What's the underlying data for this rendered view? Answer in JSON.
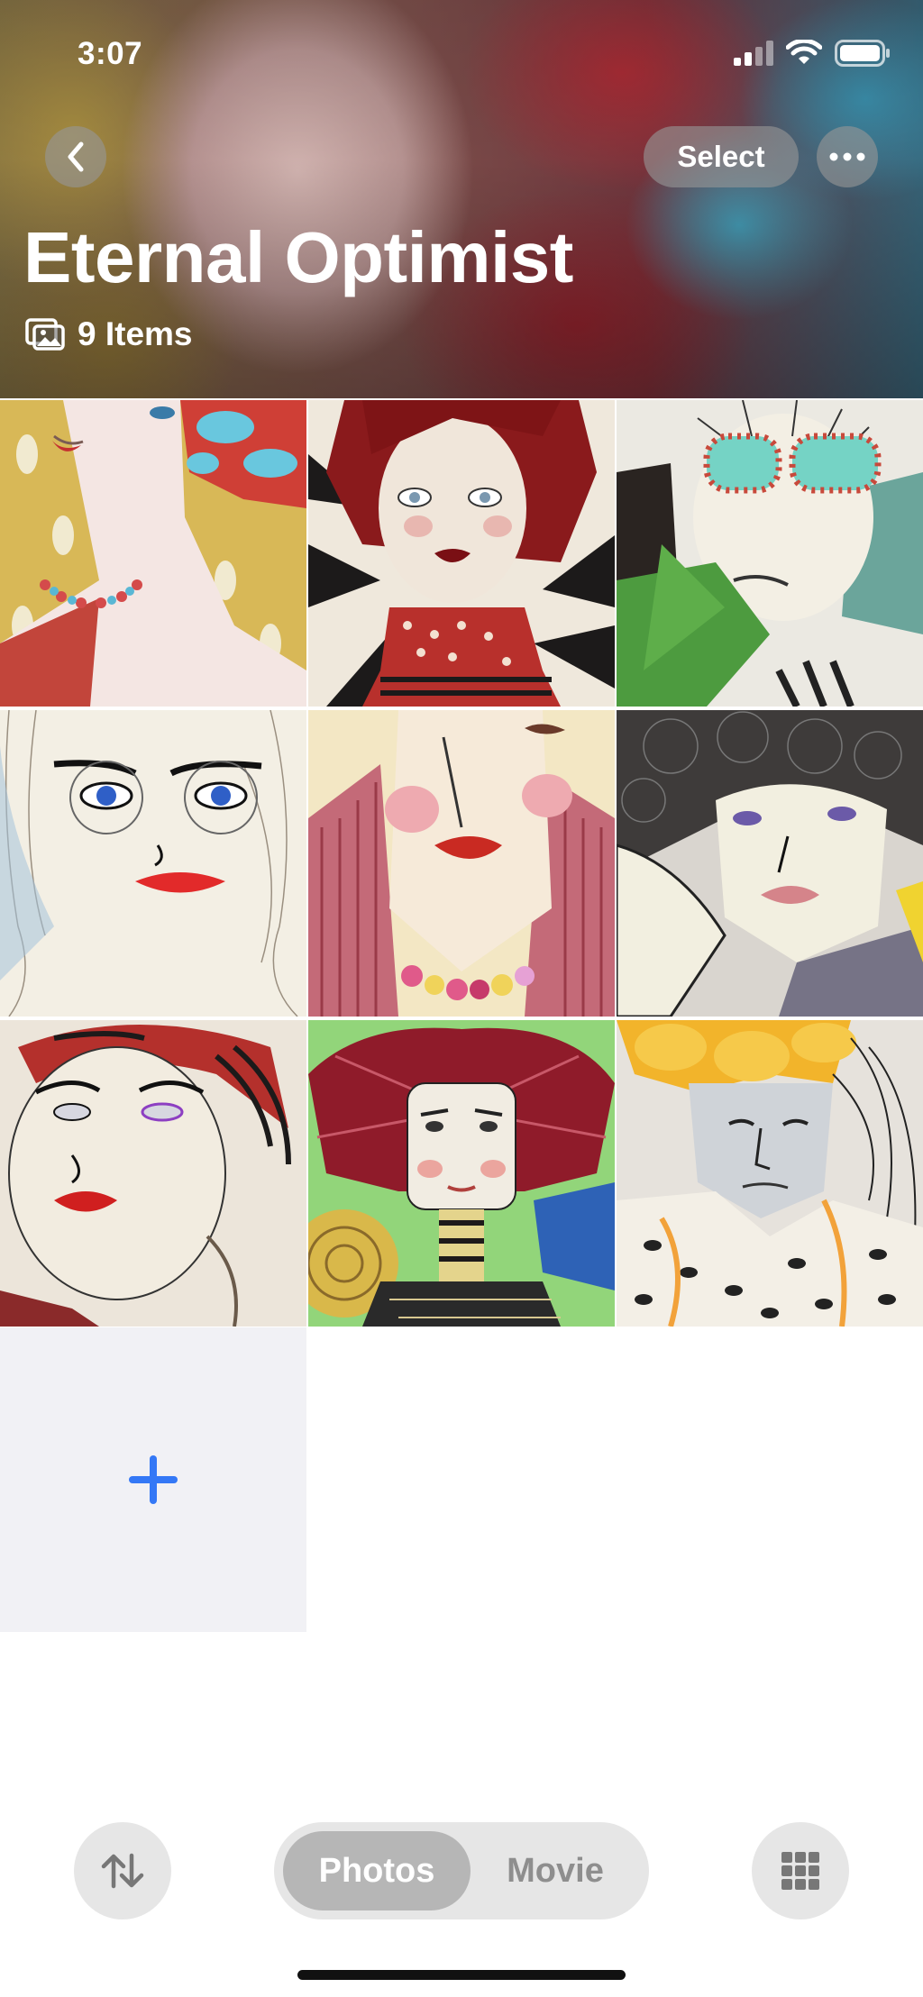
{
  "status_bar": {
    "time": "3:07",
    "icons": [
      "cellular-signal-icon",
      "wifi-icon",
      "battery-icon"
    ]
  },
  "nav": {
    "back_icon": "chevron-left-icon",
    "select_label": "Select",
    "more_icon": "ellipsis-icon"
  },
  "album": {
    "title": "Eternal Optimist",
    "count_icon": "photo-stack-icon",
    "count_label": "9 Items"
  },
  "grid": {
    "items": [
      {
        "subject": "portrait-1"
      },
      {
        "subject": "portrait-2"
      },
      {
        "subject": "portrait-3"
      },
      {
        "subject": "portrait-4"
      },
      {
        "subject": "portrait-5"
      },
      {
        "subject": "portrait-6"
      },
      {
        "subject": "portrait-7"
      },
      {
        "subject": "portrait-8"
      },
      {
        "subject": "portrait-9"
      }
    ],
    "add_icon": "plus-icon"
  },
  "bottom_bar": {
    "sort_icon": "sort-arrows-icon",
    "segments": [
      {
        "label": "Photos",
        "selected": true
      },
      {
        "label": "Movie",
        "selected": false
      }
    ],
    "layout_icon": "grid-icon"
  },
  "colors": {
    "accent": "#3478f6",
    "segment_selected": "#b6b6b6",
    "segment_bg": "#e6e6e6",
    "add_cell_bg": "#f1f1f5"
  }
}
